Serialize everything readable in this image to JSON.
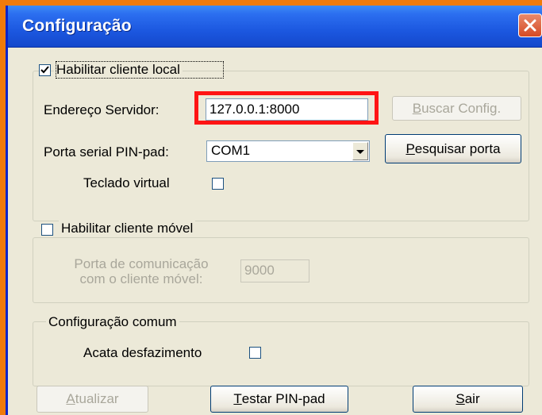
{
  "window": {
    "title": "Configuração",
    "close_icon": "close-icon"
  },
  "local_client": {
    "enable_label": "Habilitar cliente local",
    "enabled": true,
    "server_address_label": "Endereço Servidor:",
    "server_address_value": "127.0.0.1:8000",
    "fetch_config_button": "Buscar Config.",
    "fetch_config_mnemonic": "B",
    "serial_port_label": "Porta serial PIN-pad:",
    "serial_port_value": "COM1",
    "search_port_button": "Pesquisar porta",
    "search_port_mnemonic": "P",
    "virtual_keyboard_label": "Teclado virtual",
    "virtual_keyboard_checked": false
  },
  "mobile_client": {
    "enable_label": "Habilitar cliente móvel",
    "enabled": false,
    "port_label_line1": "Porta de comunicação",
    "port_label_line2": "com o cliente móvel:",
    "port_value": "9000"
  },
  "common_config": {
    "group_label": "Configuração comum",
    "acata_label": "Acata desfazimento",
    "acata_checked": false
  },
  "footer": {
    "update_button": "Atualizar",
    "update_mnemonic": "A",
    "test_button": "Testar PIN-pad",
    "test_mnemonic": "T",
    "exit_button": "Sair",
    "exit_mnemonic": "S"
  },
  "colors": {
    "highlight": "#ff1414",
    "titlebar": "#1c58e0",
    "background": "#f07b0a"
  }
}
